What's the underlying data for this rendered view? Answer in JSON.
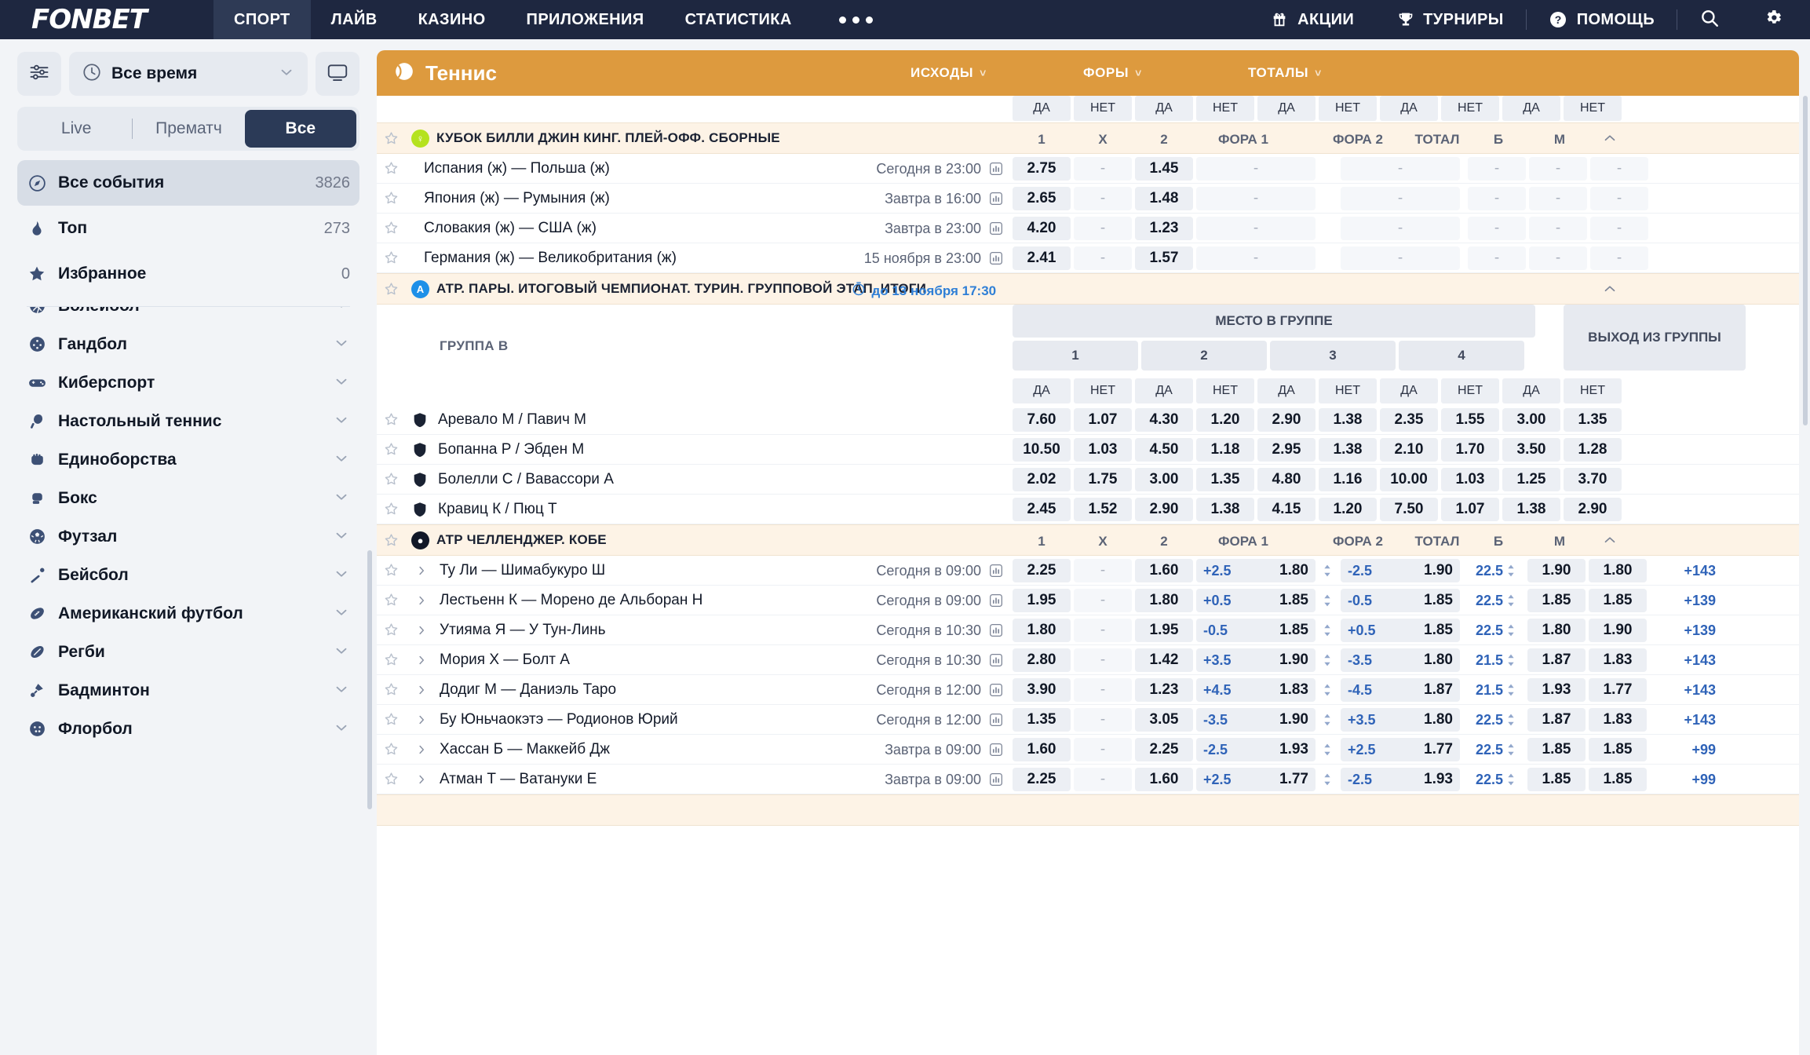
{
  "brand": "FONBET",
  "topnav": {
    "items": [
      {
        "label": "СПОРТ",
        "active": true
      },
      {
        "label": "ЛАЙВ",
        "active": false
      },
      {
        "label": "КАЗИНО",
        "active": false
      },
      {
        "label": "ПРИЛОЖЕНИЯ",
        "active": false
      },
      {
        "label": "СТАТИСТИКА",
        "active": false
      }
    ],
    "more": "•••",
    "right": [
      {
        "label": "АКЦИИ",
        "icon": "gift-icon"
      },
      {
        "label": "ТУРНИРЫ",
        "icon": "trophy-icon"
      },
      {
        "label": "ПОМОЩЬ",
        "icon": "help-icon"
      }
    ],
    "search_icon": "search-icon",
    "settings_icon": "gear-icon"
  },
  "sidebar": {
    "filter_icon": "sliders-icon",
    "time_filter": {
      "icon": "clock-icon",
      "label": "Все время",
      "chevron": "chevron-down-icon"
    },
    "display_icon": "monitor-icon",
    "segments": [
      {
        "label": "Live",
        "active": false
      },
      {
        "label": "Прематч",
        "active": false
      },
      {
        "label": "Все",
        "active": true
      }
    ],
    "fixed_items": [
      {
        "label": "Все события",
        "count": "3826",
        "icon": "compass-icon",
        "selected": true
      },
      {
        "label": "Топ",
        "count": "273",
        "icon": "flame-icon",
        "selected": false
      },
      {
        "label": "Избранное",
        "count": "0",
        "icon": "star-icon",
        "selected": false
      }
    ],
    "sports": [
      {
        "label": "Волейбол",
        "icon": "volleyball-icon"
      },
      {
        "label": "Гандбол",
        "icon": "handball-icon"
      },
      {
        "label": "Киберспорт",
        "icon": "gamepad-icon"
      },
      {
        "label": "Настольный теннис",
        "icon": "tabletennis-icon"
      },
      {
        "label": "Единоборства",
        "icon": "fist-icon"
      },
      {
        "label": "Бокс",
        "icon": "boxing-icon"
      },
      {
        "label": "Футзал",
        "icon": "futsal-icon"
      },
      {
        "label": "Бейсбол",
        "icon": "baseball-icon"
      },
      {
        "label": "Американский футбол",
        "icon": "amfootball-icon"
      },
      {
        "label": "Регби",
        "icon": "rugby-icon"
      },
      {
        "label": "Бадминтон",
        "icon": "badminton-icon"
      },
      {
        "label": "Флорбол",
        "icon": "floorball-icon"
      }
    ]
  },
  "sport_header": {
    "title": "Теннис",
    "icon": "tennis-ball-icon",
    "market_groups": [
      {
        "label": "ИСХОДЫ",
        "chevron": "chevron-down-icon"
      },
      {
        "label": "ФОРЫ",
        "chevron": "chevron-down-icon"
      },
      {
        "label": "ТОТАЛЫ",
        "chevron": "chevron-down-icon"
      }
    ]
  },
  "yes_no_bar": [
    "ДА",
    "НЕТ",
    "ДА",
    "НЕТ",
    "ДА",
    "НЕТ",
    "ДА",
    "НЕТ",
    "ДА",
    "НЕТ"
  ],
  "match_columns": [
    "1",
    "X",
    "2",
    "ФОРА 1",
    "ФОРА 2",
    "ТОТАЛ",
    "Б",
    "М"
  ],
  "sections": [
    {
      "type": "matches",
      "name": "КУБОК БИЛЛИ ДЖИН КИНГ. ПЛЕЙ-ОФФ. СБОРНЫЕ",
      "badge_color": "#b5e21f",
      "badge_glyph": "♀",
      "timer": "",
      "collapse_icon": "chevron-up-icon",
      "rows": [
        {
          "name": "Испания (ж) — Польша (ж)",
          "time": "Сегодня в 23:00",
          "stats_icon": "bar-chart-icon",
          "o1": "2.75",
          "ox": "-",
          "o2": "1.45",
          "h1": "-",
          "h2": "-",
          "tot": "-",
          "over": "-",
          "under": "-",
          "more": ""
        },
        {
          "name": "Япония (ж) — Румыния (ж)",
          "time": "Завтра в 16:00",
          "stats_icon": "bar-chart-icon",
          "o1": "2.65",
          "ox": "-",
          "o2": "1.48",
          "h1": "-",
          "h2": "-",
          "tot": "-",
          "over": "-",
          "under": "-",
          "more": ""
        },
        {
          "name": "Словакия (ж) — США (ж)",
          "time": "Завтра в 23:00",
          "stats_icon": "bar-chart-icon",
          "o1": "4.20",
          "ox": "-",
          "o2": "1.23",
          "h1": "-",
          "h2": "-",
          "tot": "-",
          "over": "-",
          "under": "-",
          "more": ""
        },
        {
          "name": "Германия (ж) — Великобритания (ж)",
          "time": "15 ноября в 23:00",
          "stats_icon": "bar-chart-icon",
          "o1": "2.41",
          "ox": "-",
          "o2": "1.57",
          "h1": "-",
          "h2": "-",
          "tot": "-",
          "over": "-",
          "under": "-",
          "more": ""
        }
      ]
    },
    {
      "type": "group",
      "name": "АТР. ПАРЫ. ИТОГОВЫЙ ЧЕМПИОНАТ. ТУРИН. ГРУППОВОЙ ЭТАП. ИТОГИ",
      "badge_color": "#1e90e8",
      "badge_glyph": "A",
      "timer": "до 13 ноября 17:30",
      "timer_icon": "stopwatch-icon",
      "collapse_icon": "chevron-up-icon",
      "group_label": "ГРУППА B",
      "super_headers": [
        {
          "label": "МЕСТО В ГРУППЕ",
          "span": 8
        },
        {
          "label": "ВЫХОД ИЗ ГРУППЫ",
          "span": 2
        }
      ],
      "place_headers": [
        "1",
        "2",
        "3",
        "4"
      ],
      "yes_no": [
        "ДА",
        "НЕТ",
        "ДА",
        "НЕТ",
        "ДА",
        "НЕТ",
        "ДА",
        "НЕТ",
        "ДА",
        "НЕТ"
      ],
      "rows": [
        {
          "name": "Аревало М / Павич М",
          "shield": true,
          "odds": [
            "7.60",
            "1.07",
            "4.30",
            "1.20",
            "2.90",
            "1.38",
            "2.35",
            "1.55",
            "3.00",
            "1.35"
          ]
        },
        {
          "name": "Бопанна Р / Эбден М",
          "shield": true,
          "odds": [
            "10.50",
            "1.03",
            "4.50",
            "1.18",
            "2.95",
            "1.38",
            "2.10",
            "1.70",
            "3.50",
            "1.28"
          ]
        },
        {
          "name": "Болелли С / Вавассори А",
          "shield": true,
          "odds": [
            "2.02",
            "1.75",
            "3.00",
            "1.35",
            "4.80",
            "1.16",
            "10.00",
            "1.03",
            "1.25",
            "3.70"
          ]
        },
        {
          "name": "Кравиц К / Пюц Т",
          "shield": true,
          "odds": [
            "2.45",
            "1.52",
            "2.90",
            "1.38",
            "4.15",
            "1.20",
            "7.50",
            "1.07",
            "1.38",
            "2.90"
          ]
        }
      ]
    },
    {
      "type": "matches",
      "name": "АТР ЧЕЛЛЕНДЖЕР. КОБЕ",
      "badge_color": "#111827",
      "badge_glyph": "●",
      "timer": "",
      "collapse_icon": "chevron-up-icon",
      "rows": [
        {
          "name": "Ту Ли — Шимабукуро Ш",
          "time": "Сегодня в 09:00",
          "stats_icon": "bar-chart-icon",
          "expand_icon": "chevron-right-icon",
          "o1": "2.25",
          "ox": "-",
          "o2": "1.60",
          "h1v": "+2.5",
          "h1": "1.80",
          "h2v": "-2.5",
          "h2": "1.90",
          "tot": "22.5",
          "over": "1.90",
          "under": "1.80",
          "more": "+143"
        },
        {
          "name": "Лестьенн К — Морено де Альборан Н",
          "time": "Сегодня в 09:00",
          "stats_icon": "bar-chart-icon",
          "expand_icon": "chevron-right-icon",
          "o1": "1.95",
          "ox": "-",
          "o2": "1.80",
          "h1v": "+0.5",
          "h1": "1.85",
          "h2v": "-0.5",
          "h2": "1.85",
          "tot": "22.5",
          "over": "1.85",
          "under": "1.85",
          "more": "+139"
        },
        {
          "name": "Утияма Я — У Тун-Линь",
          "time": "Сегодня в 10:30",
          "stats_icon": "bar-chart-icon",
          "expand_icon": "chevron-right-icon",
          "o1": "1.80",
          "ox": "-",
          "o2": "1.95",
          "h1v": "-0.5",
          "h1": "1.85",
          "h2v": "+0.5",
          "h2": "1.85",
          "tot": "22.5",
          "over": "1.80",
          "under": "1.90",
          "more": "+139"
        },
        {
          "name": "Мория Х — Болт А",
          "time": "Сегодня в 10:30",
          "stats_icon": "bar-chart-icon",
          "expand_icon": "chevron-right-icon",
          "o1": "2.80",
          "ox": "-",
          "o2": "1.42",
          "h1v": "+3.5",
          "h1": "1.90",
          "h2v": "-3.5",
          "h2": "1.80",
          "tot": "21.5",
          "over": "1.87",
          "under": "1.83",
          "more": "+143"
        },
        {
          "name": "Додиг М — Даниэль Таро",
          "time": "Сегодня в 12:00",
          "stats_icon": "bar-chart-icon",
          "expand_icon": "chevron-right-icon",
          "o1": "3.90",
          "ox": "-",
          "o2": "1.23",
          "h1v": "+4.5",
          "h1": "1.83",
          "h2v": "-4.5",
          "h2": "1.87",
          "tot": "21.5",
          "over": "1.93",
          "under": "1.77",
          "more": "+143"
        },
        {
          "name": "Бу Юньчаокэтэ — Родионов Юрий",
          "time": "Сегодня в 12:00",
          "stats_icon": "bar-chart-icon",
          "expand_icon": "chevron-right-icon",
          "o1": "1.35",
          "ox": "-",
          "o2": "3.05",
          "h1v": "-3.5",
          "h1": "1.90",
          "h2v": "+3.5",
          "h2": "1.80",
          "tot": "22.5",
          "over": "1.87",
          "under": "1.83",
          "more": "+143"
        },
        {
          "name": "Хассан Б — Маккейб Дж",
          "time": "Завтра в 09:00",
          "stats_icon": "bar-chart-icon",
          "expand_icon": "chevron-right-icon",
          "o1": "1.60",
          "ox": "-",
          "o2": "2.25",
          "h1v": "-2.5",
          "h1": "1.93",
          "h2v": "+2.5",
          "h2": "1.77",
          "tot": "22.5",
          "over": "1.85",
          "under": "1.85",
          "more": "+99"
        },
        {
          "name": "Атман Т — Ватануки Е",
          "time": "Завтра в 09:00",
          "stats_icon": "bar-chart-icon",
          "expand_icon": "chevron-right-icon",
          "o1": "2.25",
          "ox": "-",
          "o2": "1.60",
          "h1v": "+2.5",
          "h1": "1.77",
          "h2v": "-2.5",
          "h2": "1.93",
          "tot": "22.5",
          "over": "1.85",
          "under": "1.85",
          "more": "+99"
        }
      ]
    }
  ]
}
